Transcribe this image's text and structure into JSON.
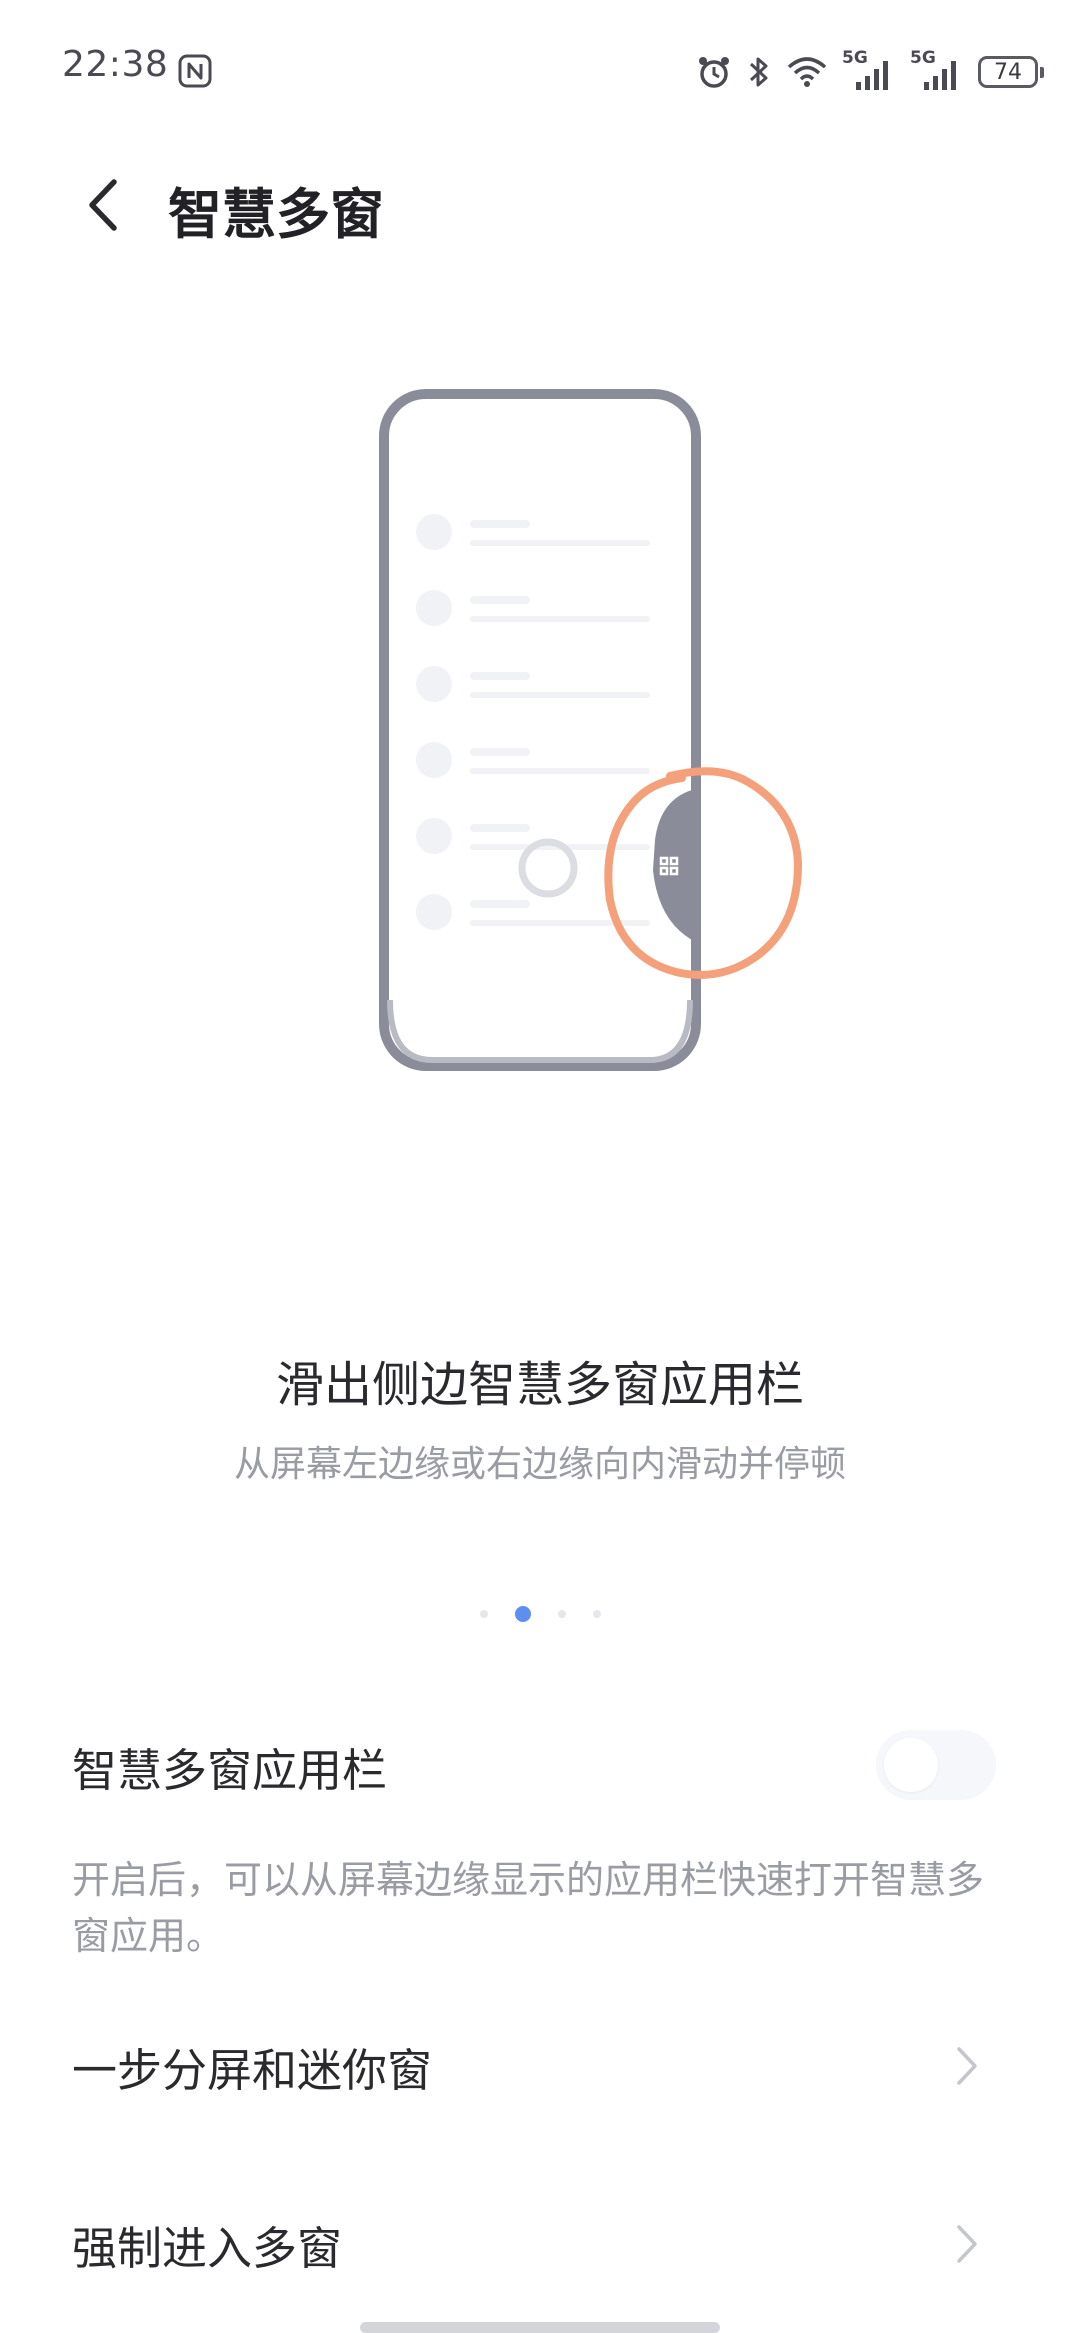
{
  "status_bar": {
    "time": "22:38",
    "network_1": "5G",
    "network_2": "5G",
    "battery": "74",
    "icons": [
      "nfc-icon",
      "alarm-icon",
      "bluetooth-icon",
      "wifi-icon",
      "signal-icon",
      "signal-icon",
      "battery-icon"
    ]
  },
  "header": {
    "title": "智慧多窗",
    "back_icon": "chevron-left-icon"
  },
  "guide": {
    "title": "滑出侧边智慧多窗应用栏",
    "subtitle": "从屏幕左边缘或右边缘向内滑动并停顿",
    "page_count": 4,
    "active_page": 2
  },
  "settings": {
    "app_bar": {
      "label": "智慧多窗应用栏",
      "enabled": false,
      "description": "开启后，可以从屏幕边缘显示的应用栏快速打开智慧多窗应用。"
    },
    "one_step": {
      "label": "一步分屏和迷你窗"
    },
    "force_multi": {
      "label": "强制进入多窗"
    }
  },
  "colors": {
    "accent": "#5d8ff0",
    "annotation_circle": "#f4a07a",
    "phone_frame": "#8a8d99"
  }
}
